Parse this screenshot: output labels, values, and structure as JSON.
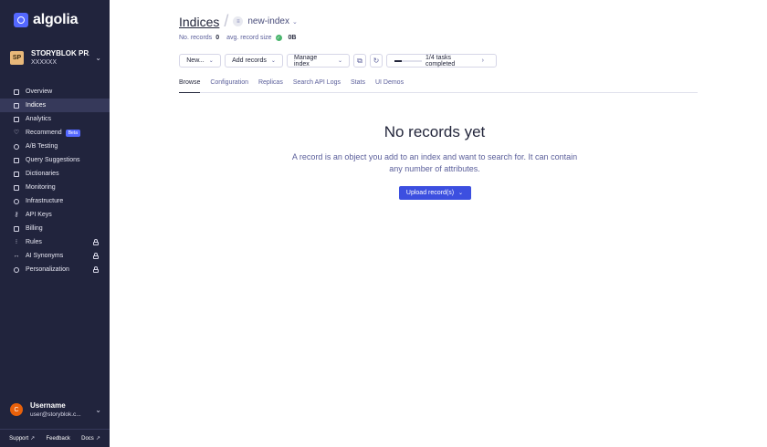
{
  "brand": {
    "name": "algolia"
  },
  "app": {
    "avatar": "SP",
    "name": "STORYBLOK PR...",
    "id": "XXXXXX"
  },
  "nav": {
    "items": [
      {
        "label": "Overview",
        "icon": "home-icon"
      },
      {
        "label": "Indices",
        "icon": "indices-icon",
        "active": true
      },
      {
        "label": "Analytics",
        "icon": "analytics-icon"
      },
      {
        "label": "Recommend",
        "icon": "heart-icon",
        "badge": "Beta"
      },
      {
        "label": "A/B Testing",
        "icon": "ab-testing-icon"
      },
      {
        "label": "Query Suggestions",
        "icon": "suggestions-icon"
      },
      {
        "label": "Dictionaries",
        "icon": "book-icon"
      },
      {
        "label": "Monitoring",
        "icon": "monitor-icon"
      },
      {
        "label": "Infrastructure",
        "icon": "globe-icon"
      },
      {
        "label": "API Keys",
        "icon": "key-icon"
      },
      {
        "label": "Billing",
        "icon": "billing-icon"
      },
      {
        "label": "Rules",
        "icon": "rules-icon",
        "locked": true
      },
      {
        "label": "AI Synonyms",
        "icon": "synonyms-icon",
        "locked": true
      },
      {
        "label": "Personalization",
        "icon": "personalization-icon",
        "locked": true
      }
    ]
  },
  "user": {
    "avatar": "C",
    "name": "Username",
    "email": "user@storyblok.c..."
  },
  "footer": {
    "support": "Support",
    "feedback": "Feedback",
    "docs": "Docs"
  },
  "header": {
    "title": "Indices",
    "index_name": "new-index"
  },
  "stats": {
    "records_label": "No. records",
    "records_value": "0",
    "size_label": "avg. record size",
    "size_value": "0B"
  },
  "toolbar": {
    "new_label": "New...",
    "add_label": "Add records",
    "manage_label": "Manage index",
    "tasks_label": "1/4 tasks completed",
    "tasks_progress": 0.25
  },
  "tabs": [
    "Browse",
    "Configuration",
    "Replicas",
    "Search API Logs",
    "Stats",
    "UI Demos"
  ],
  "empty_state": {
    "title": "No records yet",
    "description": "A record is an object you add to an index and want to search for. It can contain any number of attributes.",
    "button": "Upload record(s)"
  },
  "colors": {
    "sidebar": "#21243d",
    "accent": "#5468ff",
    "primary_button": "#3c4fe0"
  }
}
